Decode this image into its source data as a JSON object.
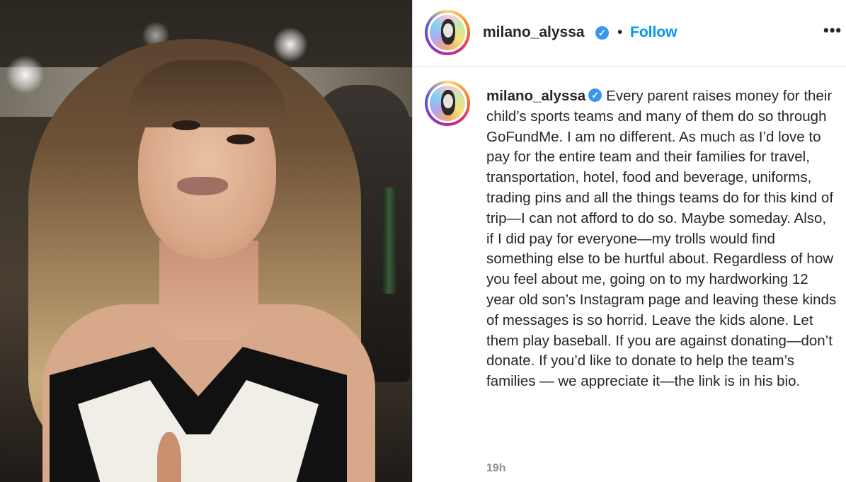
{
  "post": {
    "username": "milano_alyssa",
    "verified_icon": "verified-badge-icon",
    "separator": "•",
    "follow_label": "Follow",
    "more_label": "•••",
    "caption": "Every parent raises money for their child’s sports teams and many of them do so through GoFundMe. I am no different. As much as I’d love to pay for the entire team and their families for travel, transportation, hotel, food and beverage, uniforms, trading pins and all the things teams do for this kind of trip—I can not afford to do so. Maybe someday. Also, if I did pay for everyone—my trolls would find something else to be hurtful about. Regardless of how you feel about me, going on to my hardworking 12 year old son’s Instagram page and leaving these kinds of messages is so horrid. Leave the kids alone. Let them play baseball. If you are against donating—don’t donate. If you’d like to donate to help the team’s families — we appreciate it—the link is in his bio.",
    "timestamp": "19h"
  },
  "colors": {
    "follow": "#0095f6",
    "verified": "#3897f0",
    "text": "#262626",
    "muted": "#8e8e8e"
  }
}
